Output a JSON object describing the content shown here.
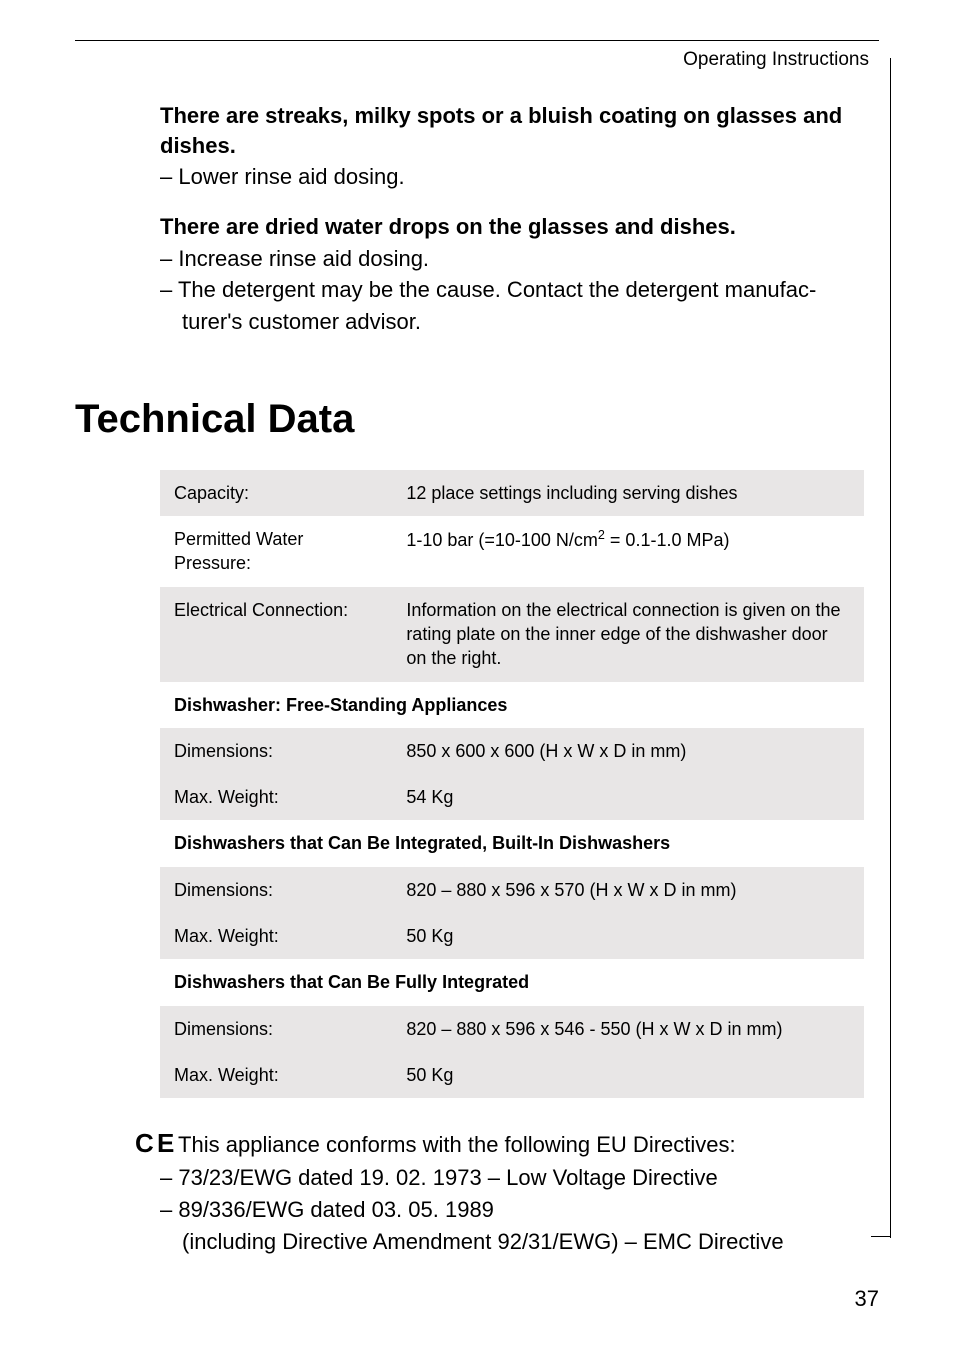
{
  "header": {
    "title": "Operating Instructions"
  },
  "troubleshooting": {
    "issue1": {
      "heading": "There are streaks, milky spots or a bluish coating on glasses and dishes.",
      "remedy1": "– Lower rinse aid dosing."
    },
    "issue2": {
      "heading": "There are dried water drops on the glasses and dishes.",
      "remedy1": "– Increase rinse aid dosing.",
      "remedy2_line1": "– The detergent may be the cause. Contact the detergent manufac-",
      "remedy2_line2": "turer's customer advisor."
    }
  },
  "main_heading": "Technical Data",
  "table": {
    "rows": [
      {
        "label": "Capacity:",
        "value": "12 place settings including serving dishes"
      },
      {
        "label": "Permitted Water Pressure:",
        "value_html": "1-10 bar (=10-100 N/cm² = 0.1-1.0 MPa)"
      },
      {
        "label": "Electrical Connection:",
        "value": "Information on the electrical connection is given on the rating plate on the inner edge of the dishwasher door on the right."
      }
    ],
    "section1": {
      "heading": "Dishwasher: Free-Standing Appliances",
      "dimensions_label": "Dimensions:",
      "dimensions_value": "850 x 600 x 600 (H x W x D in mm)",
      "weight_label": "Max. Weight:",
      "weight_value": "54 Kg"
    },
    "section2": {
      "heading": "Dishwashers that Can Be Integrated, Built-In Dishwashers",
      "dimensions_label": "Dimensions:",
      "dimensions_value": "820 – 880 x 596 x 570 (H x W x D in mm)",
      "weight_label": "Max. Weight:",
      "weight_value": "50 Kg"
    },
    "section3": {
      "heading": "Dishwashers that Can Be Fully Integrated",
      "dimensions_label": "Dimensions:",
      "dimensions_value": "820 – 880 x 596 x 546 - 550 (H x W x D in mm)",
      "weight_label": "Max. Weight:",
      "weight_value": "50 Kg"
    }
  },
  "compliance": {
    "ce_text": " This appliance conforms with the following EU Directives:",
    "directive1": "– 73/23/EWG dated 19. 02. 1973 – Low Voltage Directive",
    "directive2_line1": "– 89/336/EWG dated 03. 05. 1989",
    "directive2_line2": "(including Directive Amendment 92/31/EWG) – EMC Directive"
  },
  "page_number": "37"
}
